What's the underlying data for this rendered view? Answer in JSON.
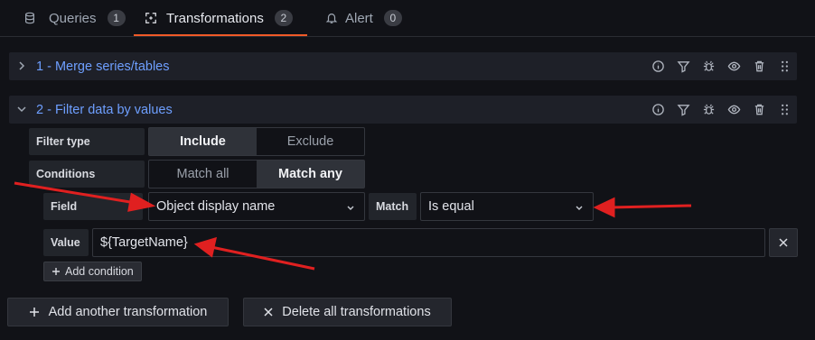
{
  "tabs": [
    {
      "label": "Queries",
      "count": "1",
      "icon": "database-icon"
    },
    {
      "label": "Transformations",
      "count": "2",
      "icon": "transform-icon"
    },
    {
      "label": "Alert",
      "count": "0",
      "icon": "bell-icon"
    }
  ],
  "transformations": [
    {
      "title": "1 - Merge series/tables"
    },
    {
      "title": "2 - Filter data by values"
    }
  ],
  "filter": {
    "filter_type_label": "Filter type",
    "include": "Include",
    "exclude": "Exclude",
    "conditions_label": "Conditions",
    "match_all": "Match all",
    "match_any": "Match any",
    "field_label": "Field",
    "field_value": "Object display name",
    "match_label": "Match",
    "match_value": "Is equal",
    "value_label": "Value",
    "value_value": "${TargetName}",
    "add_condition": "Add condition"
  },
  "footer": {
    "add_transformation": "Add another transformation",
    "delete_all": "Delete all transformations"
  },
  "colors": {
    "accent": "#f05a28",
    "link": "#6e9fff",
    "arrow": "#e02020"
  }
}
